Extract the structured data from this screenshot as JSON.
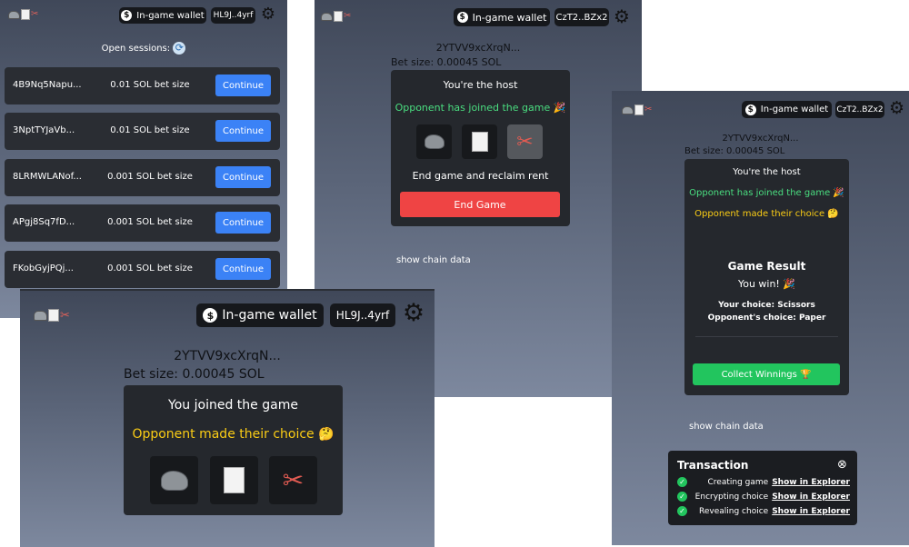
{
  "header": {
    "wallet_label": "In-game wallet",
    "coin_symbol": "$",
    "address_1": "HL9J..4yrf",
    "address_2": "CzT2..BZx2",
    "gear_icon": "⚙"
  },
  "sessions_panel": {
    "open_sessions_label": "Open sessions:",
    "sessions": [
      {
        "id": "4B9Nq5Napu...",
        "bet": "0.01 SOL bet size",
        "action": "Continue"
      },
      {
        "id": "3NptTYJaVb...",
        "bet": "0.01 SOL bet size",
        "action": "Continue"
      },
      {
        "id": "8LRMWLANof...",
        "bet": "0.001 SOL bet size",
        "action": "Continue"
      },
      {
        "id": "APgj8Sq7fD...",
        "bet": "0.001 SOL bet size",
        "action": "Continue"
      },
      {
        "id": "FKobGyjPQj...",
        "bet": "0.001 SOL bet size",
        "action": "Continue"
      }
    ]
  },
  "game": {
    "session_id": "2YTVV9xcXrqN...",
    "bet_size": "Bet size: 0.00045 SOL",
    "show_chain_data": "show chain data",
    "choices": [
      "rock-icon",
      "paper-icon",
      "scissors-icon"
    ],
    "scissors_glyph": "✂"
  },
  "host_panel": {
    "role": "You're the host",
    "opponent_joined": "Opponent has joined the game 🎉",
    "reclaim_text": "End game and reclaim rent",
    "end_button": "End Game"
  },
  "result_panel": {
    "role": "You're the host",
    "opponent_joined": "Opponent has joined the game 🎉",
    "opponent_choice": "Opponent made their choice 🤔",
    "result_title": "Game Result",
    "result_text": "You win! 🎉",
    "your_choice": "Your choice: Scissors",
    "opponent_choice_detail": "Opponent's choice: Paper",
    "collect_button": "Collect Winnings 🏆",
    "transaction": {
      "title": "Transaction",
      "close_icon": "⊗",
      "check": "✓",
      "steps": [
        {
          "label": "Creating game",
          "link": "Show in Explorer"
        },
        {
          "label": "Encrypting choice",
          "link": "Show in Explorer"
        },
        {
          "label": "Revealing choice",
          "link": "Show in Explorer"
        }
      ]
    }
  },
  "joined_panel": {
    "joined_text": "You joined the game",
    "opponent_choice": "Opponent made their choice 🤔"
  }
}
